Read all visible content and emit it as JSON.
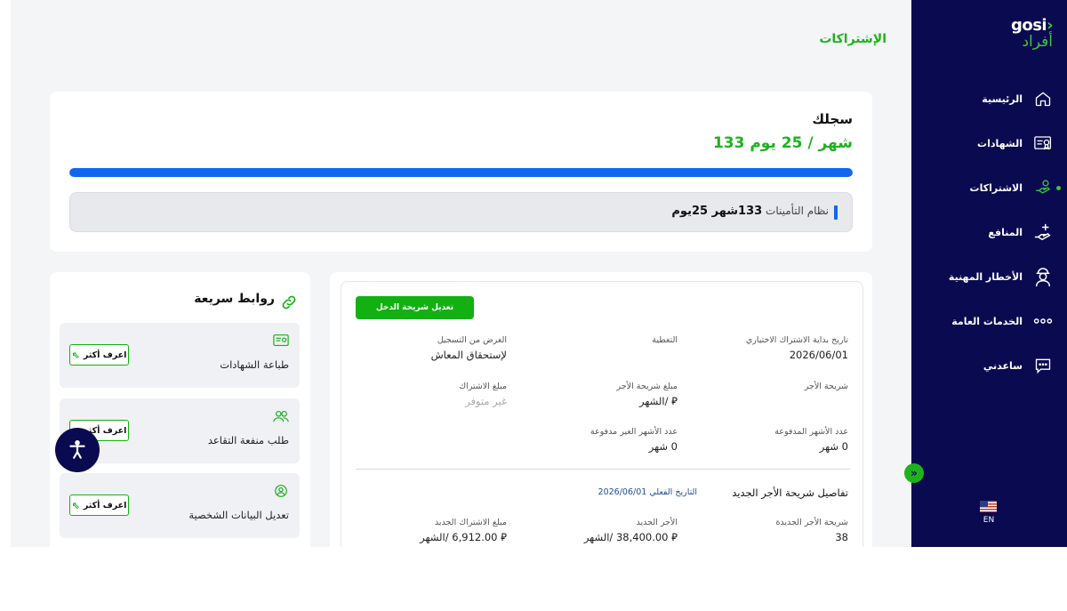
{
  "sidebar": {
    "logo_en": "gosi",
    "logo_ar": "أفراد",
    "items": [
      {
        "label": "الرئيسية",
        "icon": "home-icon"
      },
      {
        "label": "الشهادات",
        "icon": "certificate-icon"
      },
      {
        "label": "الاشتراكات",
        "icon": "subscriptions-icon",
        "active": true
      },
      {
        "label": "المنافع",
        "icon": "benefits-icon"
      },
      {
        "label": "الأخطار المهنية",
        "icon": "occupational-hazards-icon"
      },
      {
        "label": "الخدمات العامة",
        "icon": "more-dots-icon"
      },
      {
        "label": "ساعدني",
        "icon": "help-chat-icon"
      }
    ],
    "language": "EN"
  },
  "page": {
    "title": "الإشتراكات"
  },
  "record": {
    "label": "سجلك",
    "value": "133 شهر / 25 يوم",
    "progress_fraction": 1.0,
    "system_label": "نظام التأمينات",
    "system_value": "133شهر 25يوم"
  },
  "details": {
    "edit_button": "تعديل شريحة الدخل",
    "fields": [
      {
        "label": "تاريخ بداية الاشتراك الاختياري",
        "value": "2026/06/01"
      },
      {
        "label": "التغطية",
        "value": ""
      },
      {
        "label": "الغرض من التسجيل",
        "value": "لإستحقاق المعاش"
      },
      {
        "label": "شريحة الأجر",
        "value": ""
      },
      {
        "label": "مبلغ شريحة الأجر",
        "value": "/الشهر"
      },
      {
        "label": "مبلغ الاشتراك",
        "value": "غير متوفر"
      },
      {
        "label": "عدد الأشهر المدفوعة",
        "value": "0 شهر"
      },
      {
        "label": "عدد الأشهر الغير مدفوعة",
        "value": "0 شهر"
      }
    ],
    "new_slab_title": "تفاصيل شريحة الأجر الجديد",
    "effective_date": "التاريخ الفعلي 2026/06/01",
    "new_fields": [
      {
        "label": "شريحة الأجر الجديدة",
        "value": "38"
      },
      {
        "label": "الأجر الجديد",
        "value": "38,400.00 /الشهر"
      },
      {
        "label": "مبلغ الاشتراك الجديد",
        "value": "6,912.00 /الشهر"
      }
    ],
    "currency_symbol": "⃁"
  },
  "quick_links": {
    "title": "روابط سريعة",
    "items": [
      {
        "label": "طباعة الشهادات",
        "icon": "certificate-icon",
        "button": "اعرف أكثر"
      },
      {
        "label": "طلب منفعة التقاعد",
        "icon": "users-icon",
        "button": "اعرف أكثر"
      },
      {
        "label": "تعديل البيانات الشخصية",
        "icon": "user-circle-icon",
        "button": "اعرف أكثر"
      }
    ]
  },
  "colors": {
    "brand_green": "#1db31d",
    "navy": "#0a0a50",
    "progress_blue": "#1166ee"
  }
}
